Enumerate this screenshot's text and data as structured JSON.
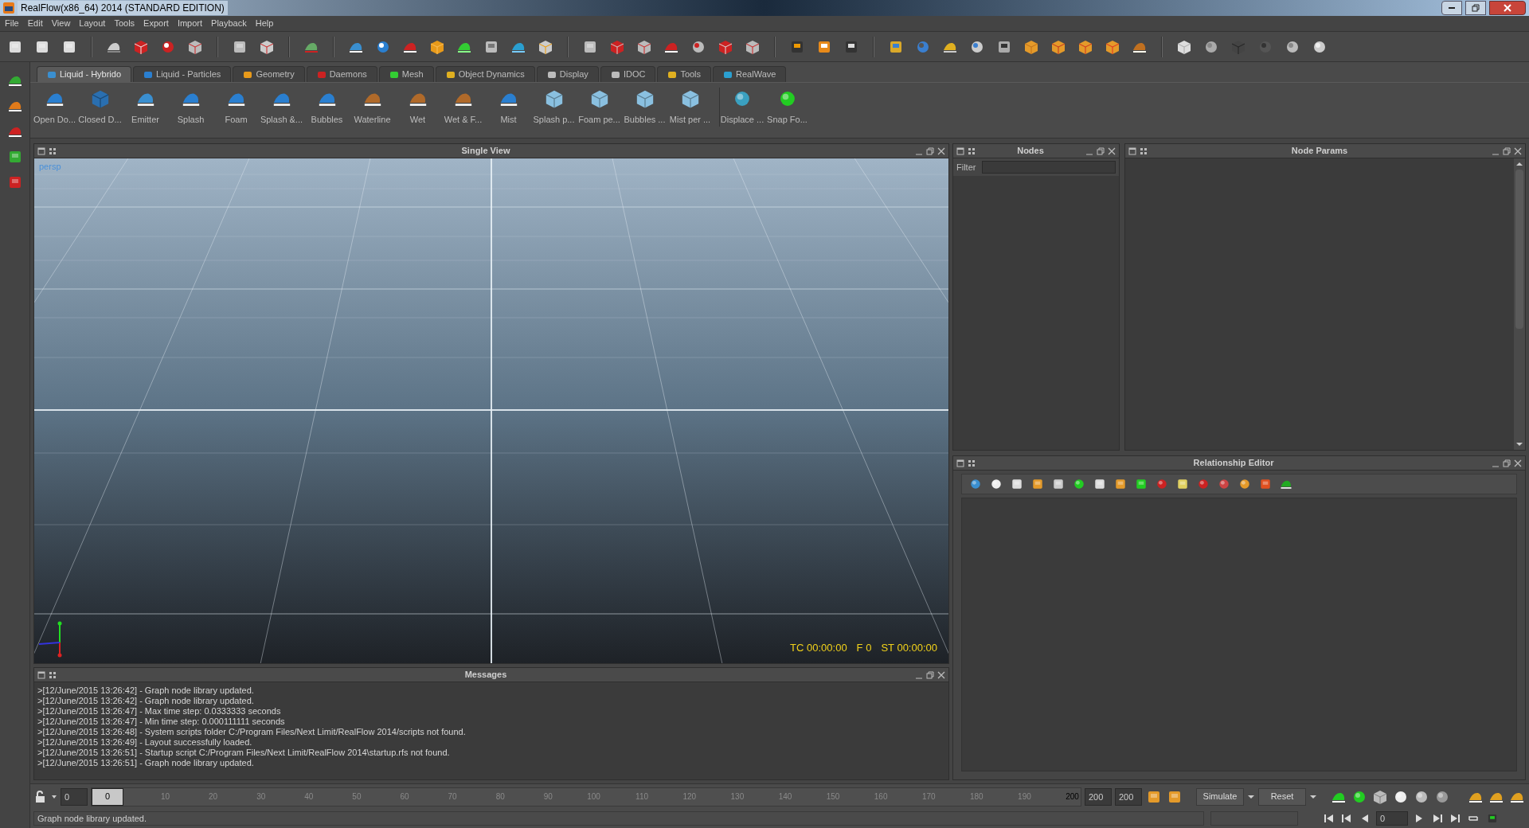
{
  "window": {
    "title": "RealFlow(x86_64) 2014  (STANDARD EDITION)"
  },
  "menu": [
    "File",
    "Edit",
    "View",
    "Layout",
    "Tools",
    "Export",
    "Import",
    "Playback",
    "Help"
  ],
  "shelf_tabs": [
    {
      "label": "Liquid - Hybrido",
      "selected": true
    },
    {
      "label": "Liquid - Particles",
      "selected": false
    },
    {
      "label": "Geometry",
      "selected": false
    },
    {
      "label": "Daemons",
      "selected": false
    },
    {
      "label": "Mesh",
      "selected": false
    },
    {
      "label": "Object Dynamics",
      "selected": false
    },
    {
      "label": "Display",
      "selected": false
    },
    {
      "label": "IDOC",
      "selected": false
    },
    {
      "label": "Tools",
      "selected": false
    },
    {
      "label": "RealWave",
      "selected": false
    }
  ],
  "shelf_items": [
    "Open Do...",
    "Closed D...",
    "Emitter",
    "Splash",
    "Foam",
    "Splash &...",
    "Bubbles",
    "Waterline",
    "Wet",
    "Wet & F...",
    "Mist",
    "Splash p...",
    "Foam pe...",
    "Bubbles ...",
    "Mist per ...",
    "Displace ...",
    "Snap Fo..."
  ],
  "viewport": {
    "title": "Single View",
    "camera": "persp",
    "timecode": "TC 00:00:00",
    "frame": "F 0",
    "sim_time": "ST 00:00:00"
  },
  "messages": {
    "title": "Messages",
    "lines": [
      ">[12/June/2015 13:26:42] - Graph node library updated.",
      ">[12/June/2015 13:26:42] - Graph node library updated.",
      ">[12/June/2015 13:26:47] - Max time step: 0.0333333 seconds",
      ">[12/June/2015 13:26:47] - Min time step: 0.000111111 seconds",
      ">[12/June/2015 13:26:48] - System scripts folder C:/Program Files/Next Limit/RealFlow 2014/scripts not found.",
      ">[12/June/2015 13:26:49] - Layout successfully loaded.",
      ">[12/June/2015 13:26:51] - Startup script C:/Program Files/Next Limit/RealFlow 2014\\startup.rfs not found.",
      ">[12/June/2015 13:26:51] - Graph node library updated."
    ]
  },
  "nodes": {
    "title": "Nodes",
    "filter_label": "Filter"
  },
  "node_params": {
    "title": "Node Params"
  },
  "relationship_editor": {
    "title": "Relationship Editor"
  },
  "timeline": {
    "start": "0",
    "current": "0",
    "ticks": [
      "10",
      "20",
      "30",
      "40",
      "50",
      "60",
      "70",
      "80",
      "90",
      "100",
      "110",
      "120",
      "130",
      "140",
      "150",
      "160",
      "170",
      "180",
      "190",
      "200"
    ],
    "end": "200",
    "max": "200",
    "simulate": "Simulate",
    "reset": "Reset",
    "frame": "0"
  },
  "status_bar": "Graph node library updated."
}
